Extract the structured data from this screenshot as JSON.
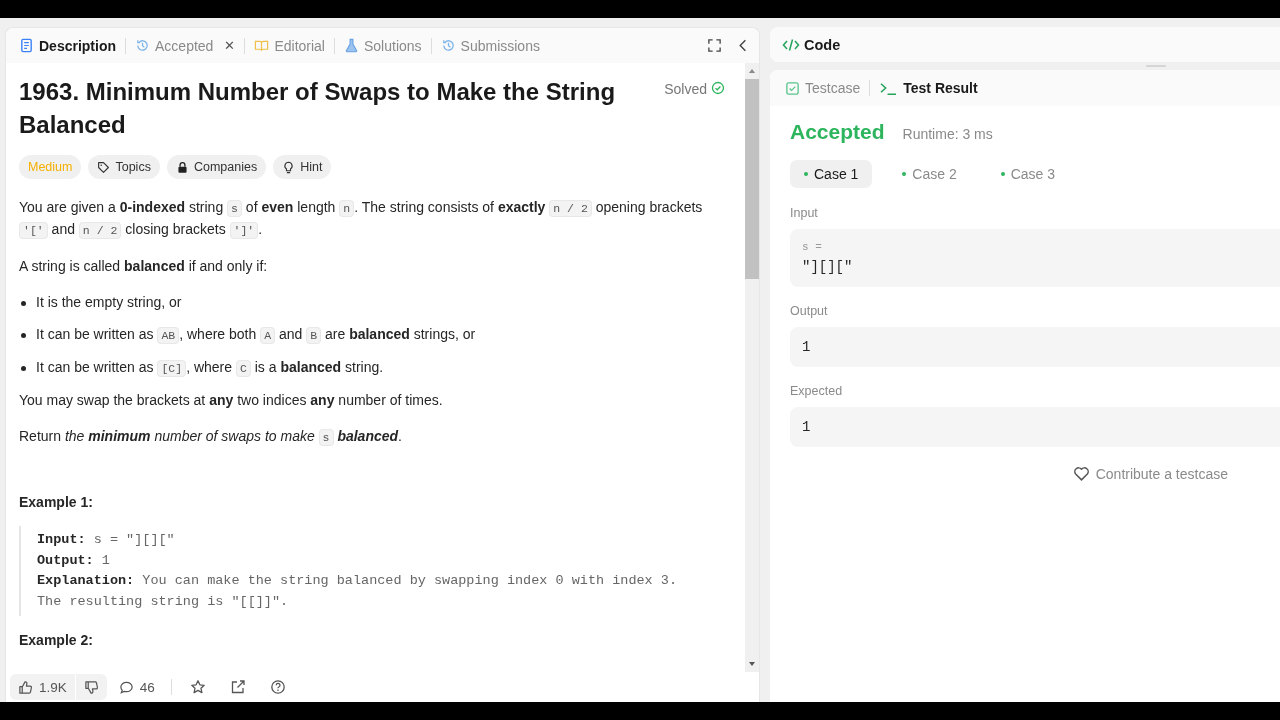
{
  "left_tabs": [
    {
      "label": "Description",
      "kind": "doc",
      "selected": true,
      "closable": false
    },
    {
      "label": "Accepted",
      "kind": "history",
      "selected": false,
      "closable": true
    },
    {
      "label": "Editorial",
      "kind": "book",
      "selected": false,
      "closable": false
    },
    {
      "label": "Solutions",
      "kind": "flask",
      "selected": false,
      "closable": false
    },
    {
      "label": "Submissions",
      "kind": "history",
      "selected": false,
      "closable": false
    }
  ],
  "close_glyph": "✕",
  "problem": {
    "title": "1963. Minimum Number of Swaps to Make the String Balanced",
    "status": "Solved",
    "tags": [
      {
        "label": "Medium",
        "kind": "difficulty"
      },
      {
        "label": "Topics",
        "kind": "tag"
      },
      {
        "label": "Companies",
        "kind": "lock"
      },
      {
        "label": "Hint",
        "kind": "bulb"
      }
    ],
    "blocks": [
      {
        "kind": "p",
        "parts": [
          {
            "kind": "text",
            "text": "You are given a **0-indexed** string "
          },
          {
            "kind": "code",
            "text": "s"
          },
          {
            "kind": "text",
            "text": " of **even** length "
          },
          {
            "kind": "code",
            "text": "n"
          },
          {
            "kind": "text",
            "text": ". The string consists of **exactly** "
          },
          {
            "kind": "code",
            "text": "n / 2"
          },
          {
            "kind": "text",
            "text": " opening brackets "
          },
          {
            "kind": "code",
            "text": "'['"
          },
          {
            "kind": "text",
            "text": " and "
          },
          {
            "kind": "code",
            "text": "n / 2"
          },
          {
            "kind": "text",
            "text": " closing brackets "
          },
          {
            "kind": "code",
            "text": "']'"
          },
          {
            "kind": "text",
            "text": "."
          }
        ]
      },
      {
        "kind": "p",
        "parts": [
          {
            "kind": "text",
            "text": "A string is called **balanced** if and only if:"
          }
        ]
      },
      {
        "kind": "li",
        "parts": [
          {
            "kind": "text",
            "text": "It is the empty string, or"
          }
        ]
      },
      {
        "kind": "li",
        "parts": [
          {
            "kind": "text",
            "text": "It can be written as "
          },
          {
            "kind": "code",
            "text": "AB"
          },
          {
            "kind": "text",
            "text": ", where both "
          },
          {
            "kind": "code",
            "text": "A"
          },
          {
            "kind": "text",
            "text": " and "
          },
          {
            "kind": "code",
            "text": "B"
          },
          {
            "kind": "text",
            "text": " are **balanced** strings, or"
          }
        ]
      },
      {
        "kind": "li",
        "parts": [
          {
            "kind": "text",
            "text": "It can be written as "
          },
          {
            "kind": "code",
            "text": "[C]"
          },
          {
            "kind": "text",
            "text": ", where "
          },
          {
            "kind": "code",
            "text": "C"
          },
          {
            "kind": "text",
            "text": " is a **balanced** string."
          }
        ]
      },
      {
        "kind": "p",
        "parts": [
          {
            "kind": "text",
            "text": "You may swap the brackets at **any** two indices **any** number of times."
          }
        ]
      },
      {
        "kind": "p",
        "parts": [
          {
            "kind": "text",
            "text": "Return "
          },
          {
            "kind": "em",
            "text": "the **minimum** number of swaps to make "
          },
          {
            "kind": "code",
            "text": "s"
          },
          {
            "kind": "em",
            "text": " **balanced**"
          },
          {
            "kind": "text",
            "text": "."
          }
        ]
      }
    ],
    "examples": [
      {
        "title": "Example 1:",
        "lines": [
          {
            "label": "Input:",
            "value": "s = \"][][\""
          },
          {
            "label": "Output:",
            "value": "1"
          },
          {
            "label": "Explanation:",
            "value": "You can make the string balanced by swapping index 0 with index 3.\nThe resulting string is \"[[]]\"."
          }
        ]
      },
      {
        "title": "Example 2:"
      }
    ]
  },
  "bottom_bar": {
    "likes": "1.9K",
    "comments": "46"
  },
  "code_header": {
    "title": "Code"
  },
  "result_tabs": [
    {
      "label": "Testcase",
      "kind": "check",
      "selected": false
    },
    {
      "label": "Test Result",
      "kind": "terminal",
      "selected": true
    }
  ],
  "result": {
    "verdict": "Accepted",
    "runtime": "Runtime: 3 ms",
    "cases": [
      {
        "label": "Case 1",
        "selected": true
      },
      {
        "label": "Case 2",
        "selected": false
      },
      {
        "label": "Case 3",
        "selected": false
      }
    ],
    "input_label": "Input",
    "input_var": "s =",
    "input_value": "\"][][\"",
    "output_label": "Output",
    "output_value": "1",
    "expected_label": "Expected",
    "expected_value": "1",
    "contribute": "Contribute a testcase"
  }
}
